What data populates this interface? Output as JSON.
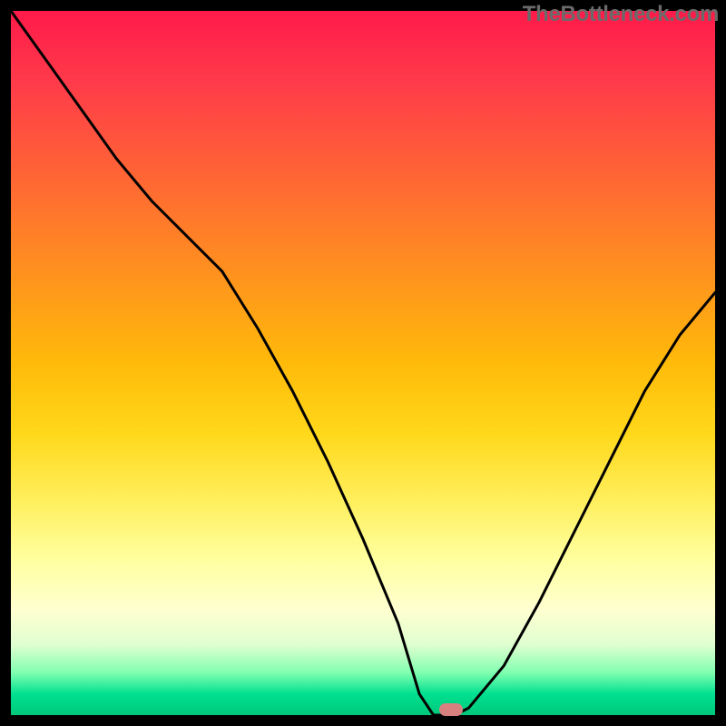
{
  "watermark": "TheBottleneck.com",
  "chart_data": {
    "type": "line",
    "x": [
      0.0,
      0.05,
      0.1,
      0.15,
      0.2,
      0.25,
      0.3,
      0.35,
      0.4,
      0.45,
      0.5,
      0.55,
      0.58,
      0.6,
      0.63,
      0.65,
      0.7,
      0.75,
      0.8,
      0.85,
      0.9,
      0.95,
      1.0
    ],
    "values": [
      1.0,
      0.93,
      0.86,
      0.79,
      0.73,
      0.68,
      0.63,
      0.55,
      0.46,
      0.36,
      0.25,
      0.13,
      0.03,
      0.0,
      0.0,
      0.01,
      0.07,
      0.16,
      0.26,
      0.36,
      0.46,
      0.54,
      0.6
    ],
    "xlim": [
      0,
      1
    ],
    "ylim": [
      0,
      1
    ],
    "xlabel": "",
    "ylabel": "",
    "title": "",
    "marker_x": 0.625,
    "marker_y": 0.0,
    "background_gradient": [
      "#ff1a4a",
      "#ff9a1a",
      "#ffd81a",
      "#ffffd0",
      "#00c87a"
    ]
  },
  "colors": {
    "frame": "#000000",
    "curve": "#000000",
    "marker": "#d88080",
    "watermark": "#6a6a6a"
  }
}
